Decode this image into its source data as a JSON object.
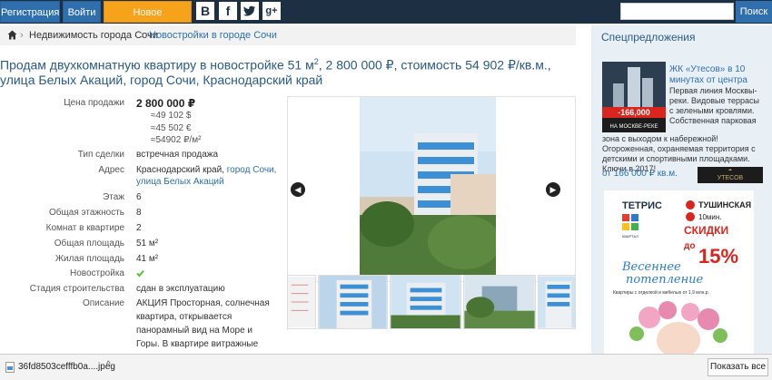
{
  "topbar": {
    "register": "Регистрация",
    "login": "Войти",
    "new_ad": "Новое объявление",
    "social": [
      "B",
      "f",
      "t",
      "g+"
    ],
    "search_placeholder": "",
    "search_button": "Поиск"
  },
  "breadcrumb": {
    "items": [
      "Недвижимость города Сочи",
      "Новостройки в городе Сочи"
    ],
    "separator": "›"
  },
  "title": {
    "main": "Продам двухкомнатную квартиру в новостройке 51 м",
    "sup": "2",
    "rest": ", 2 800 000 ₽, стоимость 54 902 ₽/кв.м., улица Белых Акаций, город Сочи, Краснодарский край"
  },
  "details": {
    "price_label": "Цена продажи",
    "price_rub": "2 800 000 ₽",
    "price_usd": "≈49 102 $",
    "price_eur": "≈45 502 €",
    "price_m2": "≈54902 ₽/м²",
    "deal_label": "Тип сделки",
    "deal_value": "встречная продажа",
    "address_label": "Адрес",
    "address_region": "Краснодарский край,",
    "address_city": "город Сочи,",
    "address_street": "улица Белых Акаций",
    "floor_label": "Этаж",
    "floor_value": "6",
    "floors_label": "Общая этажность",
    "floors_value": "8",
    "rooms_label": "Комнат в квартире",
    "rooms_value": "2",
    "area_label": "Общая площадь",
    "area_value": "51 м²",
    "living_label": "Жилая площадь",
    "living_value": "41 м²",
    "new_label": "Новостройка",
    "stage_label": "Стадия строительства",
    "stage_value": "сдан в эксплуатацию",
    "desc_label": "Описание",
    "desc_value": "АКЦИЯ Просторная, солнечная квартира, открывается панорамный вид на Море и Горы. В квартире витражные окна, качественная входная дверь"
  },
  "sidebar": {
    "title": "Спецпредложения",
    "ad1": {
      "title": "ЖК «Утесов» в 10 минутах от центра",
      "discount": "-166,000",
      "discount_caption": "НА МОСКВЕ-РЕКЕ",
      "logo_text": "УТЕСОВ",
      "text_top": "Первая линия Москвы-реки. Видовые террасы с зелеными кровлями. Собственная парковая",
      "text_bottom": "зона с выходом к набережной! Огороженная, охраняемая территория с детскими и спортивными площадками. Ключи в 2017!",
      "price": "от 166 000 ₽ кв.м."
    },
    "ad2": {
      "brand": "ТЕТРИС",
      "brand_sub": "КВАРТАЛ",
      "metro": "ТУШИНСКАЯ",
      "metro_time": "10мин.",
      "sale1": "СКИДКИ",
      "sale2": "до",
      "sale_pct": "15%",
      "slogan1": "Весеннее",
      "slogan2": "потепление",
      "note": "Квартиры с отделкой и мебелью от 1,9 млн.р."
    }
  },
  "downloads": {
    "file": "36fd8503cefffb0a....jpeg",
    "show_all": "Показать все"
  },
  "colors": {
    "topbar": "#1c2f43",
    "button": "#2f6fae",
    "accent": "#f7a21b",
    "link": "#2f6fae",
    "sidebar": "#e8f0f6"
  }
}
